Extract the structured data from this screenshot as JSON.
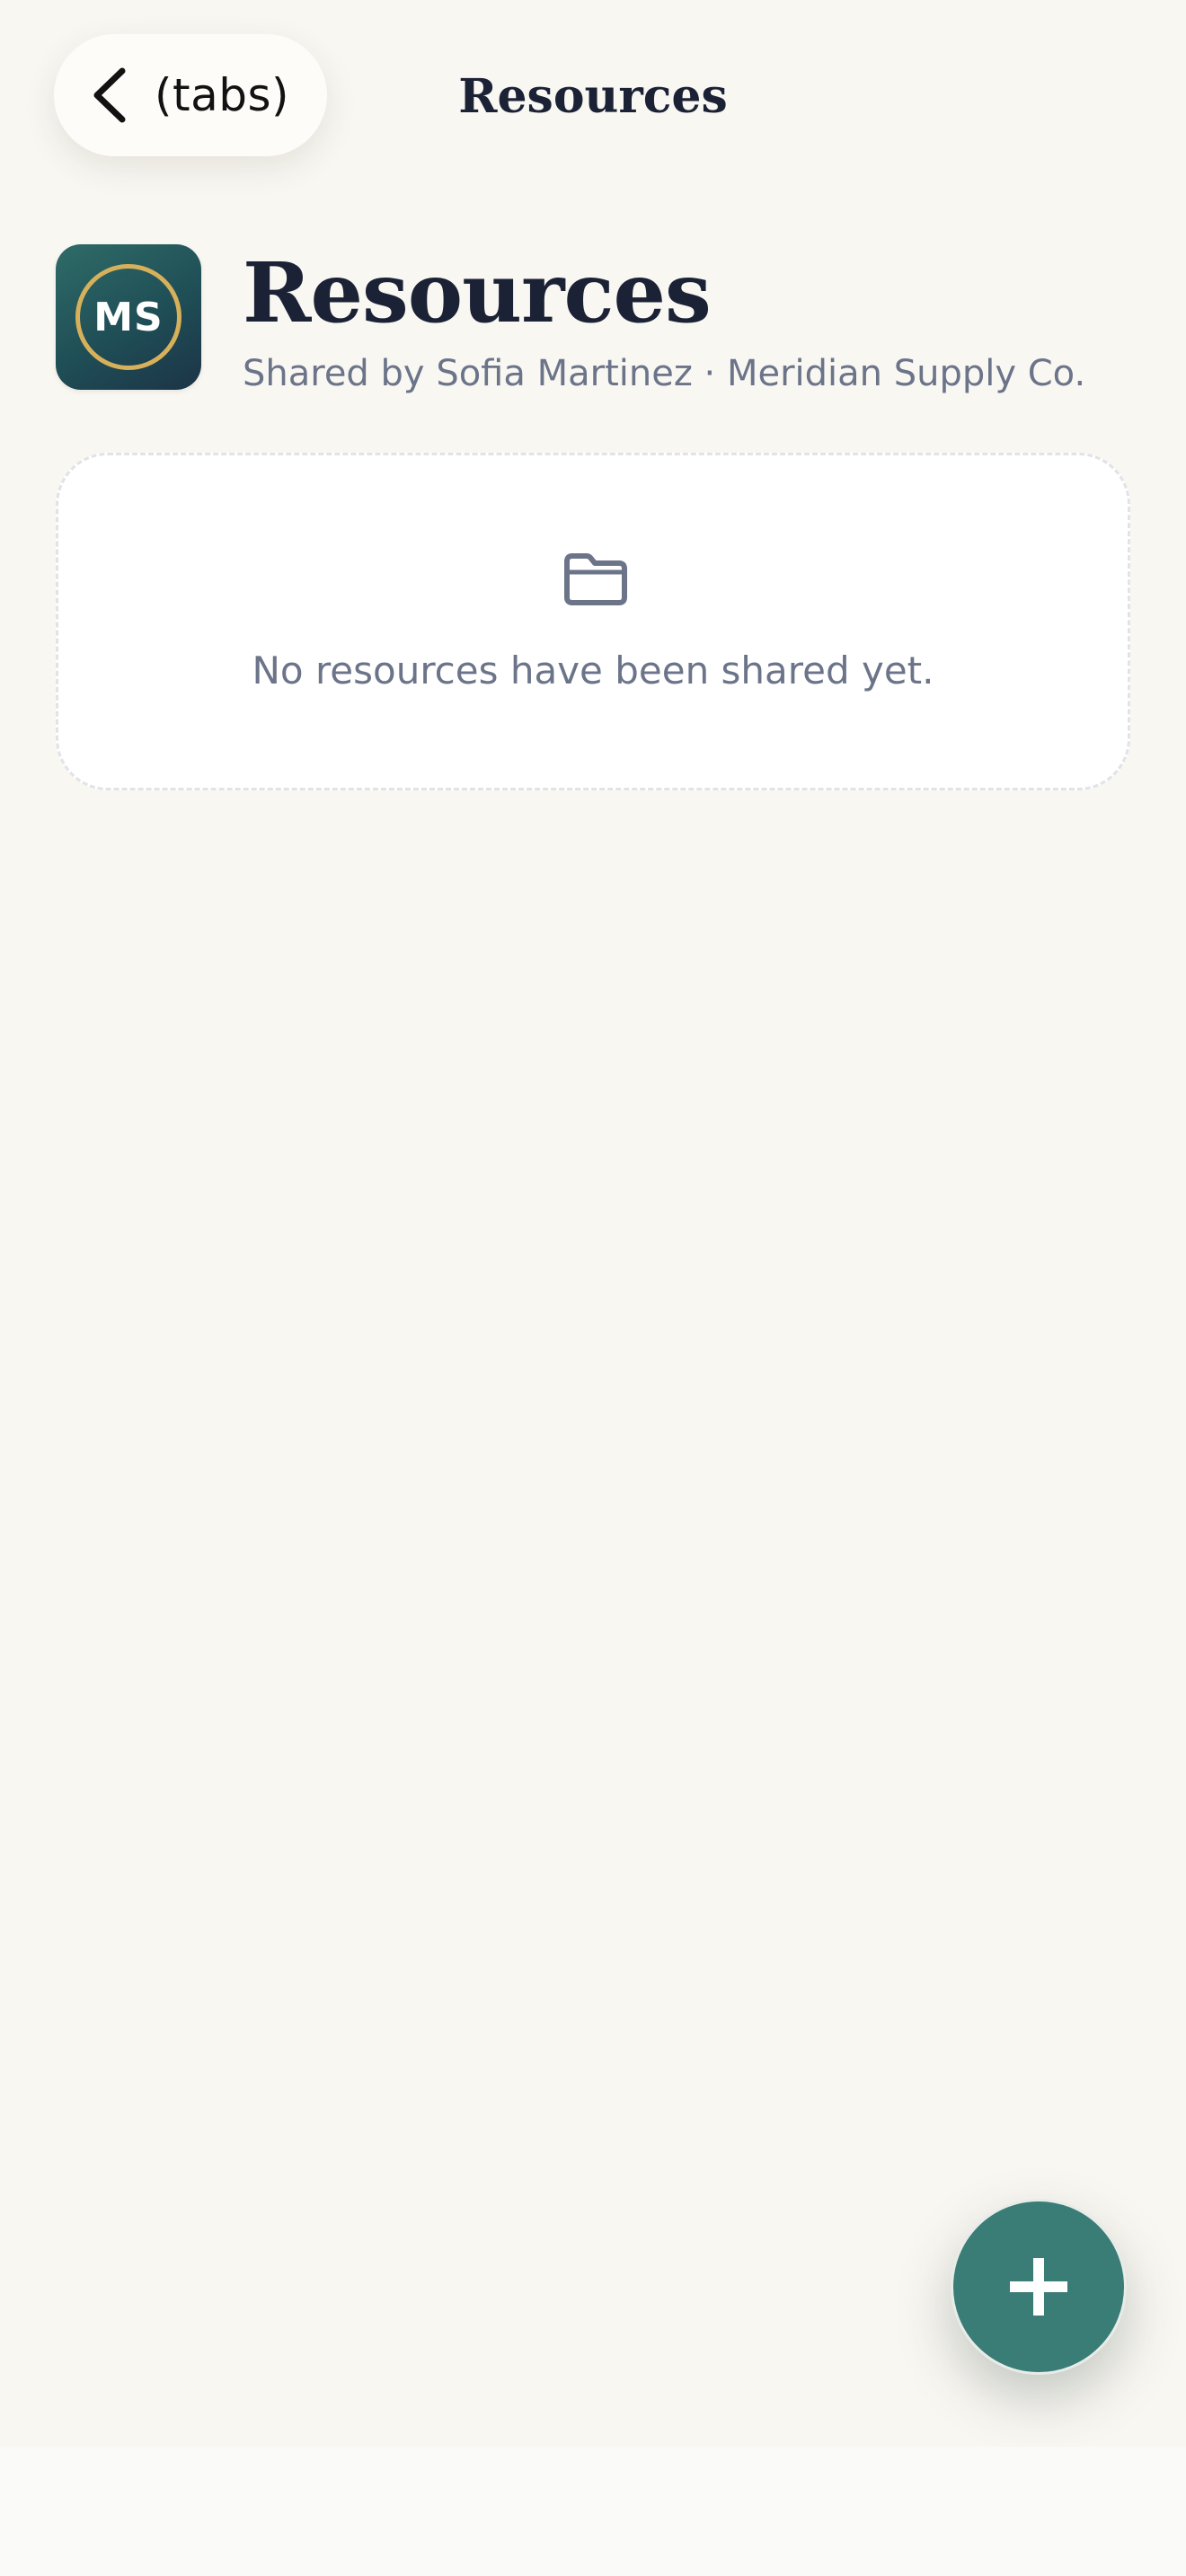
{
  "header": {
    "back_label": "(tabs)",
    "title": "Resources"
  },
  "page": {
    "badge_initials": "MS",
    "title": "Resources",
    "subtitle": "Shared by Sofia Martinez · Meridian Supply Co."
  },
  "empty_state": {
    "icon": "folder-icon",
    "message": "No resources have been shared yet."
  },
  "fab": {
    "icon": "plus-icon"
  },
  "colors": {
    "background": "#f9f7f2",
    "accent": "#3a7c76",
    "badge_ring": "#d6b05a",
    "title_text": "#1c2236",
    "muted_text": "#6b7489"
  }
}
